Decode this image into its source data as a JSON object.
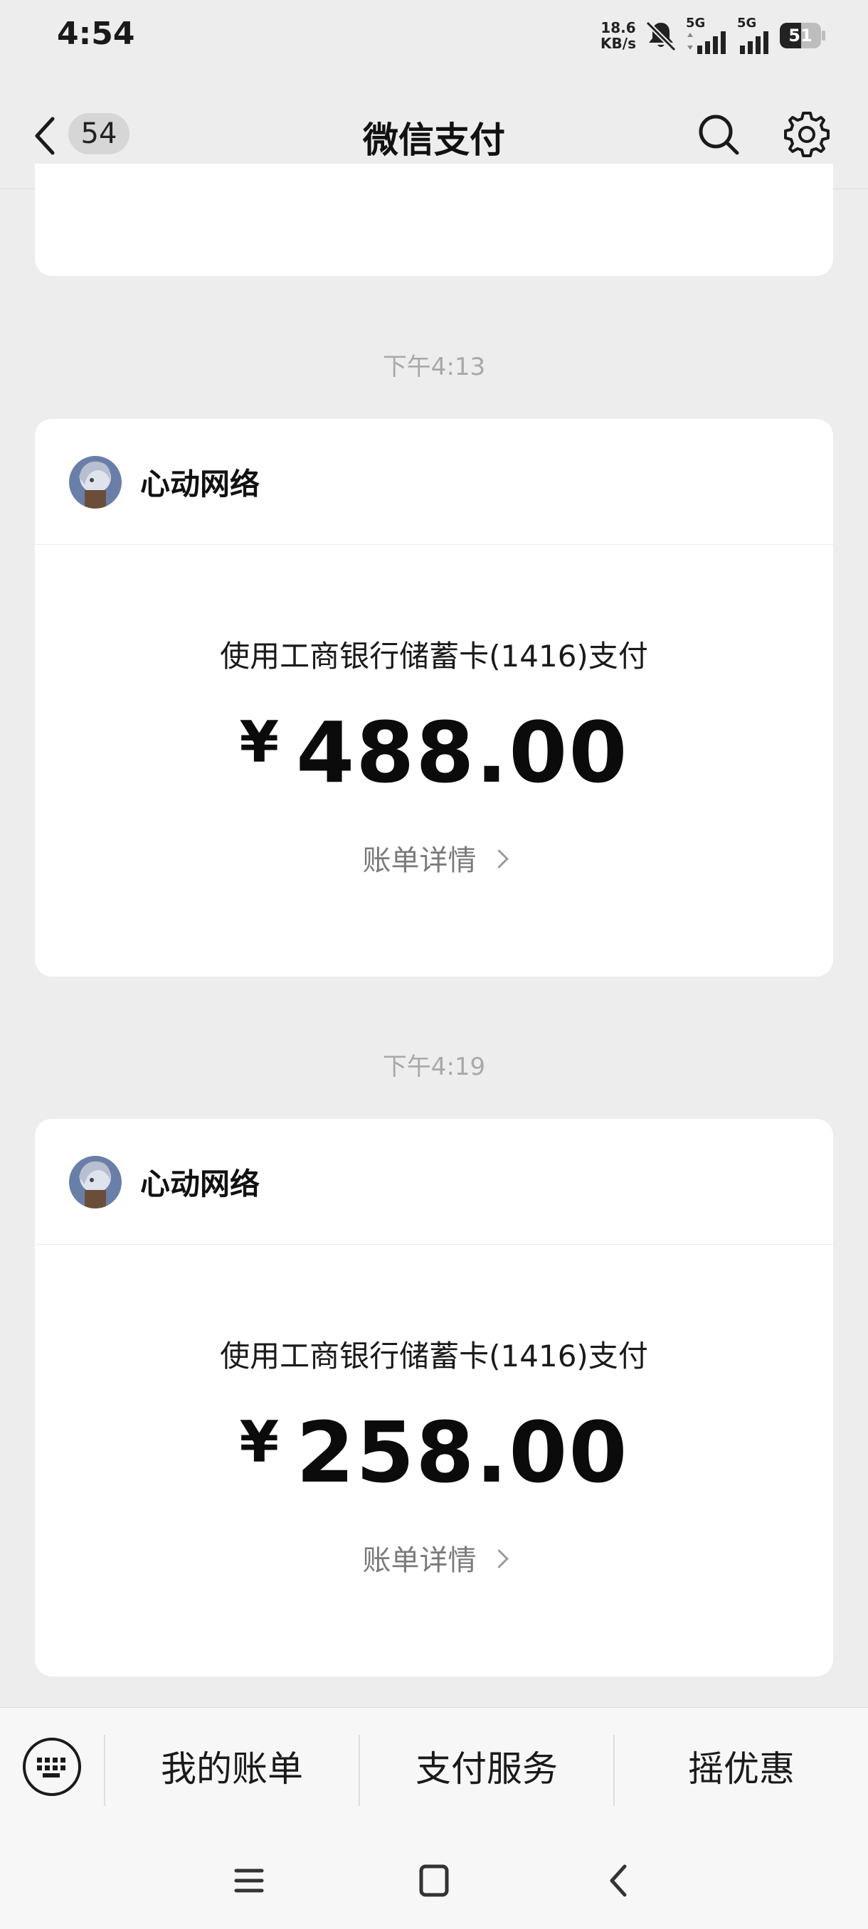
{
  "status_bar": {
    "time": "4:54",
    "net_speed_value": "18.6",
    "net_speed_unit": "KB/s",
    "signal_1_label": "5G",
    "signal_2_label": "5G",
    "battery_level": "51"
  },
  "header": {
    "unread_count": "54",
    "title": "微信支付",
    "icons": [
      "back-arrow-icon",
      "search-icon",
      "gear-icon"
    ]
  },
  "messages": [
    {
      "timestamp": "下午4:13",
      "merchant": "心动网络",
      "pay_method": "使用工商银行储蓄卡(1416)支付",
      "currency_symbol": "¥",
      "amount": "488.00",
      "detail_link": "账单详情"
    },
    {
      "timestamp": "下午4:19",
      "merchant": "心动网络",
      "pay_method": "使用工商银行储蓄卡(1416)支付",
      "currency_symbol": "¥",
      "amount": "258.00",
      "detail_link": "账单详情"
    }
  ],
  "bottom_menu": {
    "items": [
      "我的账单",
      "支付服务",
      "摇优惠"
    ],
    "keyboard_icon": "keyboard-icon"
  },
  "system_nav": [
    "menu-icon",
    "home-icon",
    "back-icon"
  ],
  "colors": {
    "background": "#ededed",
    "card": "#ffffff",
    "timestamp_text": "#a8a8a8",
    "detail_text": "#7a7a7a"
  }
}
